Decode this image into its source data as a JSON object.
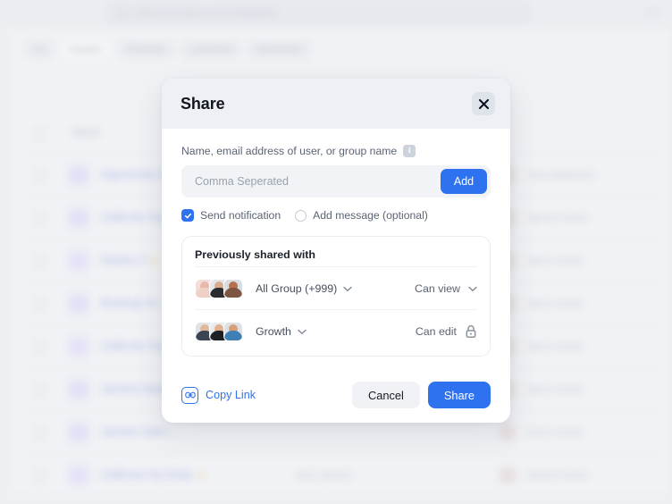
{
  "background": {
    "search": {
      "placeholder": "Search answers and pinboards",
      "go_label": "Go",
      "icon": "search-icon"
    },
    "filters": [
      {
        "label": "All",
        "active": false
      },
      {
        "label": "Answers",
        "active": true
      },
      {
        "label": "Pinboards",
        "active": false
      },
      {
        "label": "Liveboards",
        "active": false
      },
      {
        "label": "Worksheets",
        "active": false
      }
    ],
    "table": {
      "header": "Name",
      "rows": [
        {
          "name": "Opportunity S...",
          "starred": false,
          "tags": "",
          "owner": "Anna Malashine"
        },
        {
          "name": "California Top...",
          "starred": false,
          "tags": "",
          "owner": "Naresh Kumar"
        },
        {
          "name": "Pipeline 3",
          "starred": true,
          "tags": "",
          "owner": "Aaron Hunter"
        },
        {
          "name": "Bookings for ...",
          "starred": false,
          "tags": "",
          "owner": "Aaron Hunter"
        },
        {
          "name": "California Top...",
          "starred": false,
          "tags": "",
          "owner": "Aaron Hunter"
        },
        {
          "name": "Jacketts Sales ...",
          "starred": false,
          "tags": "",
          "owner": "Aaron Hunter"
        },
        {
          "name": "Jacketts Sales ...",
          "starred": false,
          "tags": "",
          "owner": "Aaron Hunter"
        },
        {
          "name": "California Top Deals",
          "starred": true,
          "tags": "sales, pipeline",
          "owner": "Naresh Kumar"
        }
      ]
    }
  },
  "modal": {
    "title": "Share",
    "close_icon": "close-icon",
    "field": {
      "label": "Name, email address of user, or group name",
      "info_icon": "info-icon",
      "info_char": "i",
      "placeholder": "Comma Seperated",
      "value": "",
      "add_label": "Add"
    },
    "options": [
      {
        "label": "Send notification",
        "checked": true,
        "type": "checkbox"
      },
      {
        "label": "Add message (optional)",
        "checked": false,
        "type": "radio"
      }
    ],
    "shared": {
      "title": "Previously shared with",
      "rows": [
        {
          "name": "All Group (+999)",
          "permission": "Can view",
          "has_caret": true,
          "perm_caret": true,
          "locked": false
        },
        {
          "name": "Growth",
          "permission": "Can edit",
          "has_caret": true,
          "perm_caret": false,
          "locked": true
        }
      ]
    },
    "footer": {
      "copy_link_label": "Copy Link",
      "copy_link_icon": "link-icon",
      "cancel_label": "Cancel",
      "share_label": "Share"
    }
  },
  "colors": {
    "accent": "#2e72f0",
    "header_bg": "#eef0f5",
    "cancel_bg": "#f1f2f6",
    "input_bg": "#f1f3f6",
    "star": "#f0b429"
  }
}
